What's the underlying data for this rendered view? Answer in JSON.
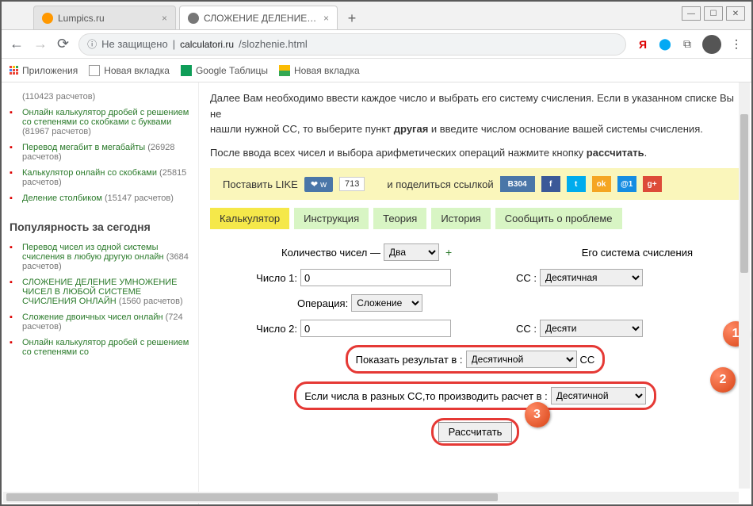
{
  "window": {
    "min": "—",
    "max": "☐",
    "close": "✕"
  },
  "tabs": [
    {
      "title": "Lumpics.ru",
      "favicon_color": "#ff9800"
    },
    {
      "title": "СЛОЖЕНИЕ ДЕЛЕНИЕ УМНОЖЕ",
      "favicon_color": "#777"
    }
  ],
  "address": {
    "not_secure": "Не защищено",
    "domain": "calculatori.ru",
    "path": "/slozhenie.html"
  },
  "bookmarks": {
    "apps": "Приложения",
    "items": [
      "Новая вкладка",
      "Google Таблицы",
      "Новая вкладка"
    ]
  },
  "sidebar": {
    "top_count": "(110423 расчетов)",
    "items1": [
      {
        "link": "Онлайн калькулятор дробей с решением со степенями со скобками с буквами",
        "count": "(81967 расчетов)"
      },
      {
        "link": "Перевод мегабит в мегабайты",
        "count": "(26928 расчетов)"
      },
      {
        "link": "Калькулятор онлайн со скобками",
        "count": "(25815 расчетов)"
      },
      {
        "link": "Деление столбиком",
        "count": "(15147 расчетов)"
      }
    ],
    "heading": "Популярность за сегодня",
    "items2": [
      {
        "link": "Перевод чисел из одной системы счисления в любую другую онлайн",
        "count": "(3684 расчетов)"
      },
      {
        "link": "СЛОЖЕНИЕ ДЕЛЕНИЕ УМНОЖЕНИЕ ЧИСЕЛ В ЛЮБОЙ СИСТЕМЕ СЧИСЛЕНИЯ ОНЛАЙН",
        "count": "(1560 расчетов)"
      },
      {
        "link": "Сложение двоичных чисел онлайн",
        "count": "(724 расчетов)"
      },
      {
        "link": "Онлайн калькулятор дробей с решением со степенями со",
        "count": ""
      }
    ]
  },
  "main": {
    "p1a": "Далее Вам необходимо ввести каждое число и выбрать его систему счисления. Если в указанном списке Вы не",
    "p1b": "нашли нужной СС, то выберите пункт ",
    "p1bold": "другая",
    "p1c": " и введите числом основание вашей системы счисления.",
    "p2a": "После ввода всех чисел и выбора арифметических операций нажмите кнопку ",
    "p2bold": "рассчитать",
    "p2b": ".",
    "like_label": "Поставить LIKE",
    "like_count": "713",
    "share_label": "и поделиться ссылкой",
    "vk_share": "304",
    "nav_tabs": [
      "Калькулятор",
      "Инструкция",
      "Теория",
      "История",
      "Сообщить о проблеме"
    ],
    "count_label": "Количество чисел —",
    "count_value": "Два",
    "system_heading": "Его система счисления",
    "num1_label": "Число 1:",
    "num1_value": "0",
    "cc_label": "СС :",
    "cc_value": "Десятичная",
    "op_label": "Операция:",
    "op_value": "Сложение",
    "num2_label": "Число 2:",
    "num2_value": "0",
    "cc2_short": "Десяти",
    "result_label": "Показать результат в :",
    "result_value": "Десятичной",
    "result_suffix": "СС",
    "diff_label": "Если числа в разных СС,то производить расчет в :",
    "diff_value": "Десятичной",
    "calc_btn": "Рассчитать",
    "badge1": "1",
    "badge2": "2",
    "badge3": "3"
  }
}
